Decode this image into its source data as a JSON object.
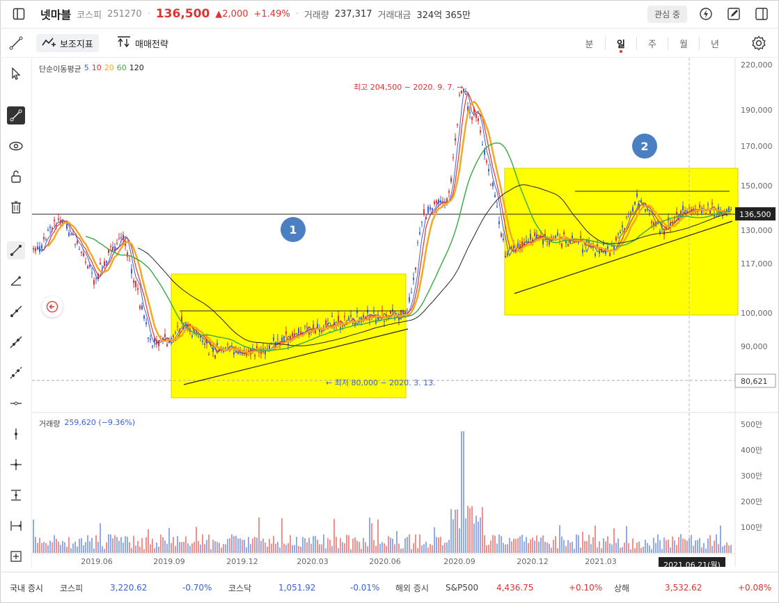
{
  "header": {
    "stock_name": "넷마블",
    "market": "코스피",
    "code": "251270",
    "price": "136,500",
    "change": "2,000",
    "change_pct": "+1.49%",
    "volume_label": "거래량",
    "volume": "237,317",
    "amount_label": "거래대금",
    "amount": "324억 365만",
    "watch_button": "관심 중"
  },
  "toolbar": {
    "indicator_label": "보조지표",
    "strategy_label": "매매전략",
    "periods": [
      "분",
      "일",
      "주",
      "월",
      "년"
    ],
    "selected_period": "일"
  },
  "chart": {
    "ma_legend_title": "단순이동평균",
    "ma_periods": [
      {
        "label": "5",
        "color": "#3a5fd9"
      },
      {
        "label": "10",
        "color": "#e0322f"
      },
      {
        "label": "20",
        "color": "#f5a623"
      },
      {
        "label": "60",
        "color": "#3fae49"
      },
      {
        "label": "120",
        "color": "#222222"
      }
    ],
    "price_axis": [
      "220,000",
      "190,000",
      "170,000",
      "150,000",
      "130,000",
      "117,000",
      "100,000",
      "90,000"
    ],
    "current_price_tag": "136,500",
    "low_line_tag": "80,621",
    "high_annotation": "최고 204,500 − 2020. 9. 7. →",
    "low_annotation": "← 최저 80,000 − 2020. 3. 13.",
    "box_label_1": "1",
    "box_label_2": "2",
    "volume_legend_title": "거래량",
    "volume_legend_value": "259,620 (−9.36%)",
    "volume_axis": [
      "500만",
      "400만",
      "300만",
      "200만",
      "100만"
    ],
    "date_axis": [
      "2019.06",
      "2019.09",
      "2019.12",
      "2020.03",
      "2020.06",
      "2020.09",
      "2020.12",
      "2021.03"
    ],
    "crosshair_date": "2021.06.21(월)",
    "colors": {
      "up": "#e0322f",
      "down": "#3a5fd9",
      "highlight_box": "#ffff00",
      "badge": "#4a7fc1"
    }
  },
  "footer": {
    "domestic_label": "국내 증시",
    "kospi_name": "코스피",
    "kospi_value": "3,220.62",
    "kospi_change": "-0.70%",
    "kosdaq_name": "코스닥",
    "kosdaq_value": "1,051.92",
    "kosdaq_change": "-0.01%",
    "overseas_label": "해외 증시",
    "sp_name": "S&P500",
    "sp_value": "4,436.75",
    "sp_change": "+0.10%",
    "shanghai_name": "상해",
    "shanghai_value": "3,532.62",
    "shanghai_change": "+0.08%"
  }
}
